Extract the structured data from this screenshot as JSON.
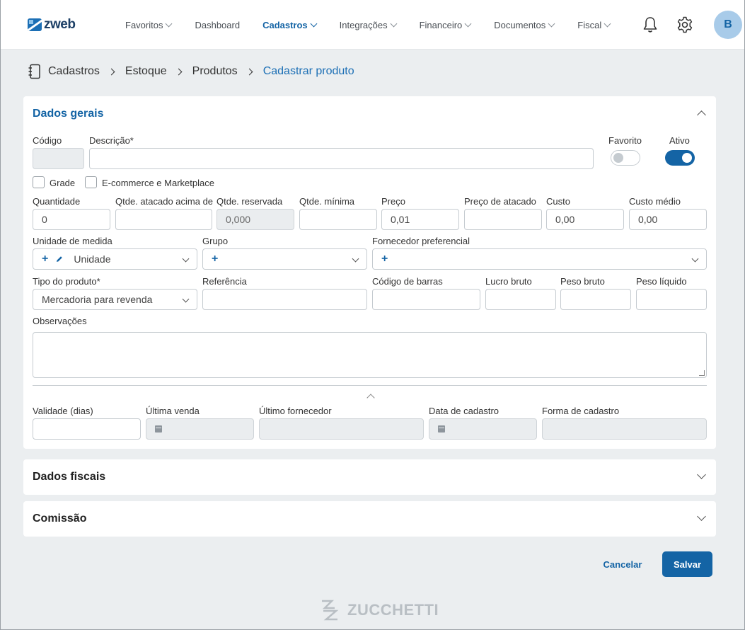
{
  "app": {
    "logo_text": "zweb"
  },
  "nav": {
    "items": [
      {
        "label": "Favoritos"
      },
      {
        "label": "Dashboard"
      },
      {
        "label": "Cadastros"
      },
      {
        "label": "Integrações"
      },
      {
        "label": "Financeiro"
      },
      {
        "label": "Documentos"
      },
      {
        "label": "Fiscal"
      }
    ],
    "active": "Cadastros",
    "avatar_initial": "B"
  },
  "breadcrumb": {
    "items": [
      "Cadastros",
      "Estoque",
      "Produtos"
    ],
    "current": "Cadastrar produto"
  },
  "dados_gerais": {
    "title": "Dados gerais",
    "codigo_label": "Código",
    "descricao_label": "Descrição*",
    "favorito_label": "Favorito",
    "favorito_on": false,
    "ativo_label": "Ativo",
    "ativo_on": true,
    "grade_label": "Grade",
    "ecommerce_label": "E-commerce e Marketplace",
    "quantidade_label": "Quantidade",
    "quantidade_value": "0",
    "qtde_atacado_label": "Qtde. atacado acima de",
    "qtde_reservada_label": "Qtde. reservada",
    "qtde_reservada_value": "0,000",
    "qtde_minima_label": "Qtde. mínima",
    "preco_label": "Preço",
    "preco_value": "0,01",
    "preco_atacado_label": "Preço de atacado",
    "custo_label": "Custo",
    "custo_value": "0,00",
    "custo_medio_label": "Custo médio",
    "custo_medio_value": "0,00",
    "unidade_label": "Unidade de medida",
    "unidade_value": "Unidade",
    "grupo_label": "Grupo",
    "fornecedor_label": "Fornecedor preferencial",
    "tipo_label": "Tipo do produto*",
    "tipo_value": "Mercadoria para revenda",
    "referencia_label": "Referência",
    "codigo_barras_label": "Código de barras",
    "lucro_bruto_label": "Lucro bruto",
    "peso_bruto_label": "Peso bruto",
    "peso_liquido_label": "Peso líquido",
    "observacoes_label": "Observações",
    "validade_label": "Validade (dias)",
    "ultima_venda_label": "Última venda",
    "ultimo_fornecedor_label": "Último fornecedor",
    "data_cadastro_label": "Data de cadastro",
    "forma_cadastro_label": "Forma de cadastro"
  },
  "dados_fiscais": {
    "title": "Dados fiscais"
  },
  "comissao": {
    "title": "Comissão"
  },
  "actions": {
    "cancel_label": "Cancelar",
    "save_label": "Salvar"
  },
  "footer": {
    "brand": "ZUCCHETTI"
  },
  "colors": {
    "accent": "#1464a5",
    "background": "#ebeef0"
  },
  "icons": [
    "bell-icon",
    "gear-icon",
    "notebook-icon",
    "calendar-icon",
    "pencil-icon",
    "plus-icon"
  ]
}
